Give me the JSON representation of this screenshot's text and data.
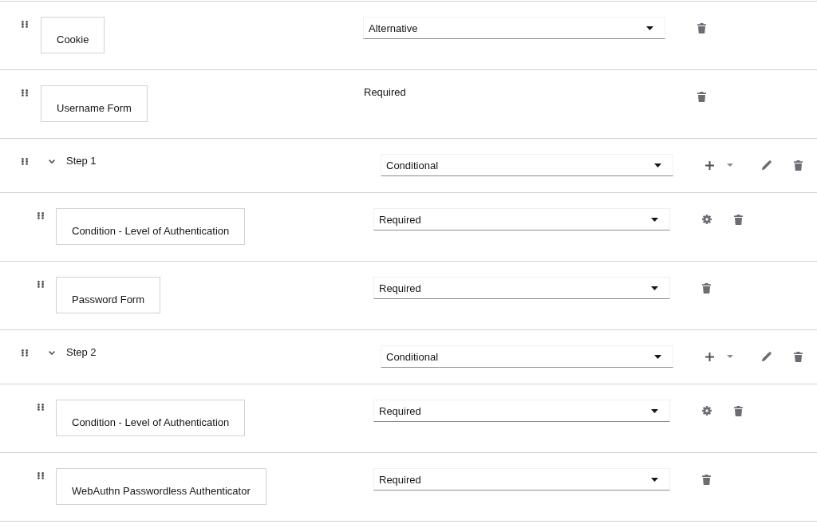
{
  "flow": [
    {
      "kind": "execution",
      "name": "Cookie",
      "requirement": {
        "kind": "dropdown",
        "value": "Alternative"
      },
      "actions": [
        {
          "kind": "delete"
        }
      ]
    },
    {
      "kind": "execution",
      "name": "Username Form",
      "requirement": {
        "kind": "text",
        "value": "Required"
      },
      "actions": [
        {
          "kind": "delete"
        }
      ]
    },
    {
      "kind": "flow",
      "name": "Step 1",
      "expanded": true,
      "requirement": {
        "kind": "dropdown",
        "value": "Conditional"
      },
      "actions": [
        {
          "kind": "add"
        },
        {
          "kind": "edit"
        },
        {
          "kind": "delete"
        }
      ],
      "children": [
        {
          "kind": "execution",
          "name": "Condition - Level of Authentication",
          "requirement": {
            "kind": "dropdown",
            "value": "Required"
          },
          "actions": [
            {
              "kind": "settings"
            },
            {
              "kind": "delete"
            }
          ]
        },
        {
          "kind": "execution",
          "name": "Password Form",
          "requirement": {
            "kind": "dropdown",
            "value": "Required"
          },
          "actions": [
            {
              "kind": "delete"
            }
          ]
        }
      ]
    },
    {
      "kind": "flow",
      "name": "Step 2",
      "expanded": true,
      "requirement": {
        "kind": "dropdown",
        "value": "Conditional"
      },
      "actions": [
        {
          "kind": "add"
        },
        {
          "kind": "edit"
        },
        {
          "kind": "delete"
        }
      ],
      "children": [
        {
          "kind": "execution",
          "name": "Condition - Level of Authentication",
          "requirement": {
            "kind": "dropdown",
            "value": "Required"
          },
          "actions": [
            {
              "kind": "settings"
            },
            {
              "kind": "delete"
            }
          ]
        },
        {
          "kind": "execution",
          "name": "WebAuthn Passwordless Authenticator",
          "requirement": {
            "kind": "dropdown",
            "value": "Required"
          },
          "actions": [
            {
              "kind": "delete"
            }
          ]
        }
      ]
    }
  ]
}
